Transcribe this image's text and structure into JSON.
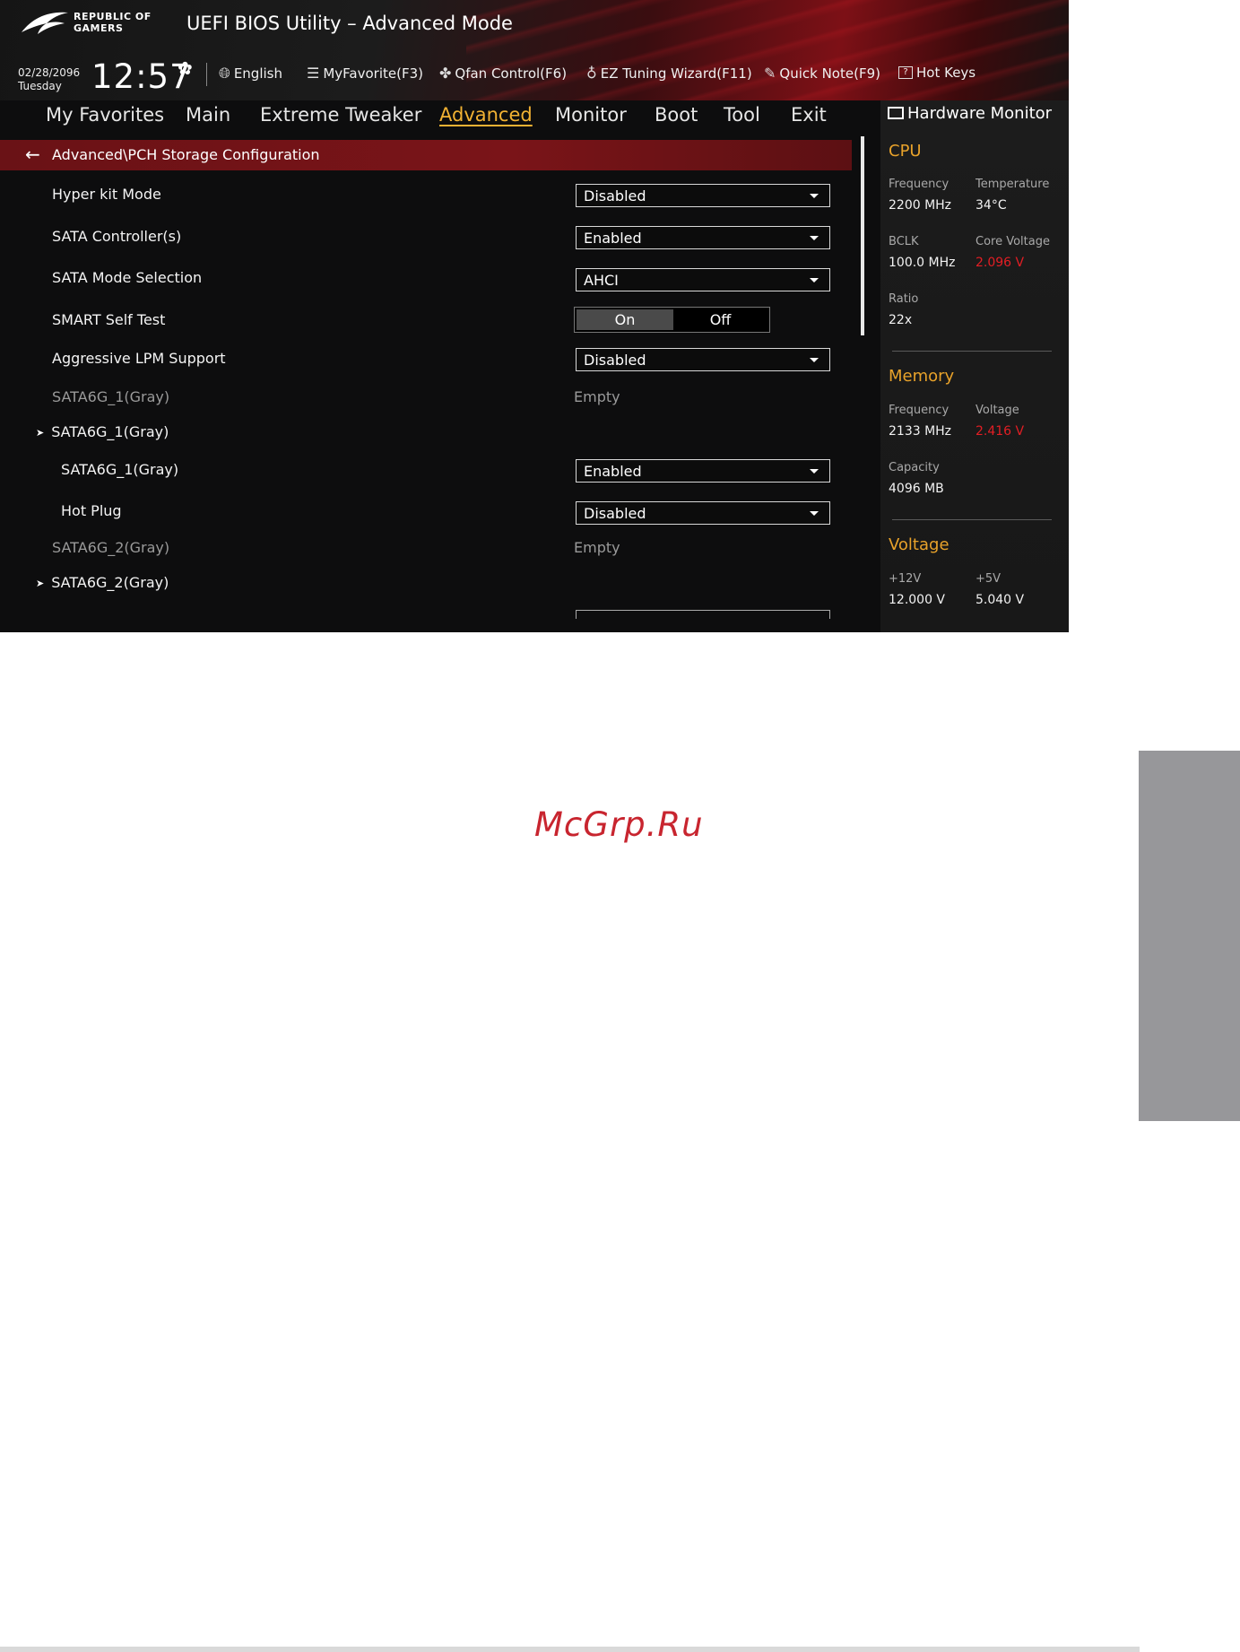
{
  "header": {
    "logo_text": "REPUBLIC OF GAMERS",
    "app_title": "UEFI BIOS Utility – Advanced Mode",
    "date": "02/28/2096",
    "day": "Tuesday",
    "time": "12:57",
    "toolbar": [
      {
        "label": "English",
        "icon": "globe-icon"
      },
      {
        "label": "MyFavorite(F3)",
        "icon": "favorite-list-icon"
      },
      {
        "label": "Qfan Control(F6)",
        "icon": "fan-icon"
      },
      {
        "label": "EZ Tuning Wizard(F11)",
        "icon": "lightbulb-icon"
      },
      {
        "label": "Quick Note(F9)",
        "icon": "note-icon"
      },
      {
        "label": "Hot Keys",
        "icon": "question-box-icon"
      }
    ]
  },
  "nav": {
    "tabs": [
      "My Favorites",
      "Main",
      "Extreme Tweaker",
      "Advanced",
      "Monitor",
      "Boot",
      "Tool",
      "Exit"
    ],
    "active": "Advanced"
  },
  "breadcrumb": "Advanced\\PCH Storage Configuration",
  "settings": [
    {
      "label": "Hyper kit Mode",
      "value": "Disabled"
    },
    {
      "label": "SATA Controller(s)",
      "value": "Enabled"
    },
    {
      "label": "SATA Mode Selection",
      "value": "AHCI"
    },
    {
      "label": "SMART Self Test",
      "toggle_on": "On",
      "toggle_off": "Off",
      "selected": "On"
    },
    {
      "label": "Aggressive LPM Support",
      "value": "Disabled"
    },
    {
      "label": "SATA6G_1(Gray)",
      "status": "Empty"
    },
    {
      "label": "SATA6G_1(Gray)"
    },
    {
      "label": "SATA6G_1(Gray)",
      "value": "Enabled"
    },
    {
      "label": "Hot Plug",
      "value": "Disabled"
    },
    {
      "label": "SATA6G_2(Gray)",
      "status": "Empty"
    },
    {
      "label": "SATA6G_2(Gray)"
    }
  ],
  "hardware_monitor": {
    "title": "Hardware Monitor",
    "cpu": {
      "heading": "CPU",
      "frequency_label": "Frequency",
      "frequency": "2200 MHz",
      "temperature_label": "Temperature",
      "temperature": "34°C",
      "bclk_label": "BCLK",
      "bclk": "100.0 MHz",
      "core_voltage_label": "Core Voltage",
      "core_voltage": "2.096 V",
      "ratio_label": "Ratio",
      "ratio": "22x"
    },
    "memory": {
      "heading": "Memory",
      "frequency_label": "Frequency",
      "frequency": "2133 MHz",
      "voltage_label": "Voltage",
      "voltage": "2.416 V",
      "capacity_label": "Capacity",
      "capacity": "4096 MB"
    },
    "voltage": {
      "heading": "Voltage",
      "v12_label": "+12V",
      "v12": "12.000 V",
      "v5_label": "+5V",
      "v5": "5.040 V"
    }
  },
  "watermark": "McGrp.Ru",
  "colors": {
    "accent_active_tab": "#f2b233",
    "section_heading": "#e8a22a",
    "warning_value": "#e31e24",
    "breadcrumb_bar": "#7a1418",
    "watermark": "#c8252f",
    "side_tab": "#97979a"
  }
}
